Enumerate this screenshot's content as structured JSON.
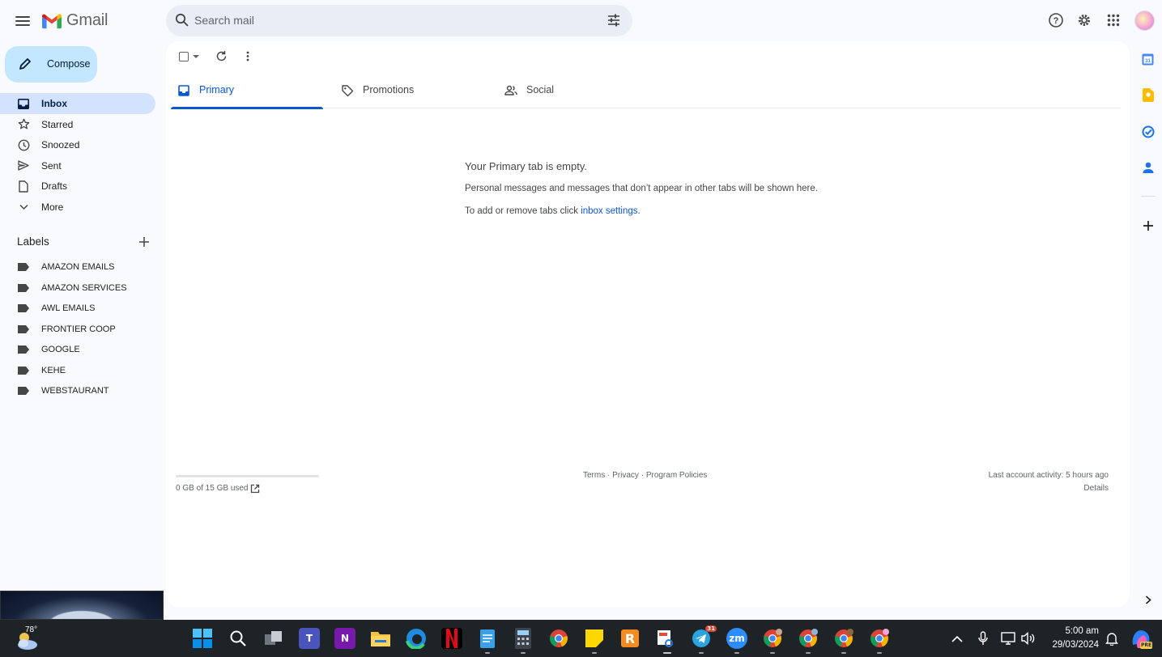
{
  "header": {
    "app_name": "Gmail",
    "search_placeholder": "Search mail"
  },
  "sidebar": {
    "compose_label": "Compose",
    "items": [
      {
        "label": "Inbox",
        "icon": "inbox-icon",
        "active": true
      },
      {
        "label": "Starred",
        "icon": "star-icon"
      },
      {
        "label": "Snoozed",
        "icon": "clock-icon"
      },
      {
        "label": "Sent",
        "icon": "send-icon"
      },
      {
        "label": "Drafts",
        "icon": "draft-icon"
      },
      {
        "label": "More",
        "icon": "chevron-down-icon"
      }
    ],
    "labels_heading": "Labels",
    "labels": [
      "AMAZON EMAILS",
      "AMAZON SERVICES",
      "AWL EMAILS",
      "FRONTIER COOP",
      "GOOGLE",
      "KEHE",
      "WEBSTAURANT"
    ]
  },
  "tabs": [
    {
      "label": "Primary",
      "icon": "inbox-tab-icon",
      "active": true
    },
    {
      "label": "Promotions",
      "icon": "tag-icon"
    },
    {
      "label": "Social",
      "icon": "people-icon"
    }
  ],
  "empty_state": {
    "title": "Your Primary tab is empty.",
    "line1": "Personal messages and messages that don’t appear in other tabs will be shown here.",
    "line2_prefix": "To add or remove tabs click ",
    "line2_link": "inbox settings",
    "line2_suffix": "."
  },
  "footer": {
    "storage": "0 GB of 15 GB used",
    "storage_fraction": 0,
    "terms": "Terms",
    "privacy": "Privacy",
    "policies": "Program Policies",
    "separator": " · ",
    "last_activity": "Last account activity: 5 hours ago",
    "details": "Details"
  },
  "taskbar": {
    "temperature": "78°",
    "time": "5:00 am",
    "date": "29/03/2024",
    "telegram_badge": "31",
    "zoom_label": "zm",
    "teams_label": "T",
    "onenote_label": "N",
    "copilot_label": "PRE"
  },
  "colors": {
    "accent": "#0b57d0",
    "compose_bg": "#c2e7ff",
    "active_nav": "#d3e3fd"
  }
}
